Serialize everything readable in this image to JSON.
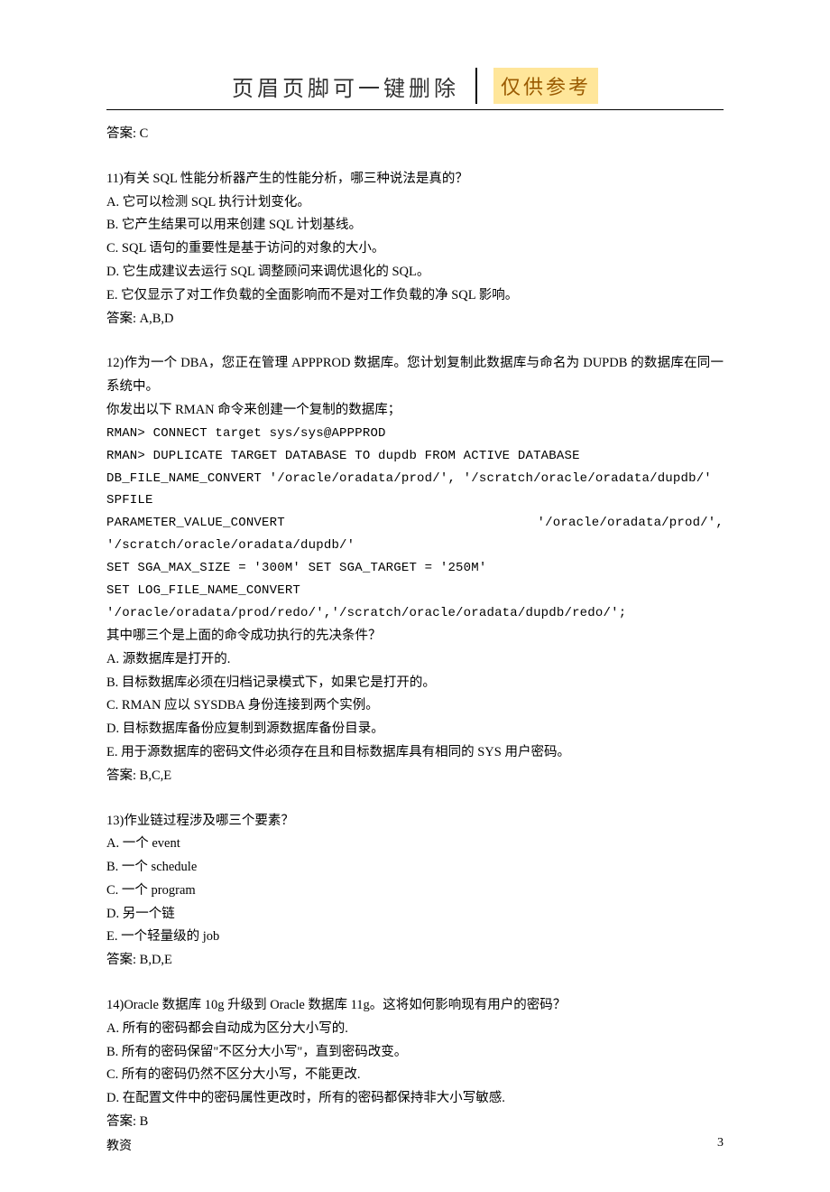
{
  "header": {
    "title": "页眉页脚可一键删除",
    "badge": "仅供参考"
  },
  "ans_c": "答案: C",
  "q11": {
    "stem": "11)有关 SQL 性能分析器产生的性能分析，哪三种说法是真的？",
    "a": "A. 它可以检测 SQL 执行计划变化。",
    "b": "B. 它产生结果可以用来创建 SQL 计划基线。",
    "c": "C. SQL 语句的重要性是基于访问的对象的大小。",
    "d": "D. 它生成建议去运行 SQL 调整顾问来调优退化的 SQL。",
    "e": "E. 它仅显示了对工作负载的全面影响而不是对工作负载的净 SQL 影响。",
    "ans": "答案: A,B,D"
  },
  "q12": {
    "stem1": "12)作为一个 DBA，您正在管理 APPPROD 数据库。您计划复制此数据库与命名为 DUPDB 的数据库在同一系统中。",
    "stem2": "你发出以下 RMAN 命令来创建一个复制的数据库；",
    "cmd1": "RMAN> CONNECT target sys/sys@APPPROD",
    "cmd2": "RMAN> DUPLICATE TARGET DATABASE TO dupdb FROM ACTIVE DATABASE",
    "cmd3": "DB_FILE_NAME_CONVERT    '/oracle/oradata/prod/',    '/scratch/oracle/oradata/dupdb/'",
    "cmd4": "SPFILE",
    "cmd5": "PARAMETER_VALUE_CONVERT  '/oracle/oradata/prod/',  '/scratch/oracle/oradata/dupdb/'",
    "cmd6": "SET SGA_MAX_SIZE = '300M' SET SGA_TARGET = '250M'",
    "cmd7": "SET LOG_FILE_NAME_CONVERT",
    "cmd8": "'/oracle/oradata/prod/redo/','/scratch/oracle/oradata/dupdb/redo/';",
    "q": "其中哪三个是上面的命令成功执行的先决条件？",
    "a": "A. 源数据库是打开的.",
    "b": "B. 目标数据库必须在归档记录模式下，如果它是打开的。",
    "c": "C. RMAN 应以 SYSDBA 身份连接到两个实例。",
    "d": "D. 目标数据库备份应复制到源数据库备份目录。",
    "e": "E. 用于源数据库的密码文件必须存在且和目标数据库具有相同的 SYS 用户密码。",
    "ans": "答案: B,C,E"
  },
  "q13": {
    "stem": "13)作业链过程涉及哪三个要素？",
    "a": "A. 一个 event",
    "b": "B. 一个 schedule",
    "c": "C. 一个 program",
    "d": "D. 另一个链",
    "e": "E. 一个轻量级的 job",
    "ans": "答案: B,D,E"
  },
  "q14": {
    "stem": "14)Oracle 数据库 10g 升级到 Oracle 数据库 11g。这将如何影响现有用户的密码？",
    "a": "A. 所有的密码都会自动成为区分大小写的.",
    "b": "B. 所有的密码保留\"不区分大小写\"，直到密码改变。",
    "c": "C. 所有的密码仍然不区分大小写，不能更改.",
    "d": "D. 在配置文件中的密码属性更改时，所有的密码都保持非大小写敏感.",
    "ans": "答案: B"
  },
  "footer": {
    "left": "教资",
    "right": "3"
  }
}
